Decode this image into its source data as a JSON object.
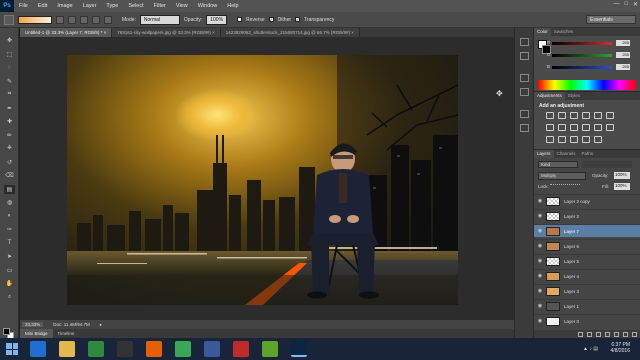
{
  "app": {
    "logo": "Ps"
  },
  "menu": [
    "File",
    "Edit",
    "Image",
    "Layer",
    "Type",
    "Select",
    "Filter",
    "View",
    "Window",
    "Help"
  ],
  "window_controls": {
    "minimize": "—",
    "maximize": "□",
    "close": "✕"
  },
  "options": {
    "mode_label": "Mode:",
    "mode_value": "Normal",
    "opacity_label": "Opacity:",
    "opacity_value": "100%",
    "reverse_label": "Reverse",
    "dither_label": "Dither",
    "transparency_label": "Transparency",
    "reverse_checked": false,
    "dither_checked": true,
    "transparency_checked": true,
    "workspace": "Essentials"
  },
  "doc_tabs": [
    {
      "label": "Untitled-1 @ 33.3% (Layer 7, RGB/8) *",
      "close": "×",
      "active": true
    },
    {
      "label": "769161-city-wallpapers.jpg @ 33.3% (RGB/8#)",
      "close": "×",
      "active": false
    },
    {
      "label": "1423829062_shutterstock_215680714.jpg @ 66.7% (RGB/8#)",
      "close": "×",
      "active": false
    }
  ],
  "status": {
    "zoom": "33.33%",
    "doc": "Doc: 11.4M/94.7M"
  },
  "bottom_tabs": [
    "Mini Bridge",
    "Timeline"
  ],
  "tools": [
    "move-tool-icon",
    "marquee-tool-icon",
    "lasso-tool-icon",
    "quick-select-tool-icon",
    "crop-tool-icon",
    "eyedropper-tool-icon",
    "healing-tool-icon",
    "brush-tool-icon",
    "clone-stamp-tool-icon",
    "history-brush-tool-icon",
    "eraser-tool-icon",
    "gradient-tool-icon",
    "blur-tool-icon",
    "dodge-tool-icon",
    "pen-tool-icon",
    "type-tool-icon",
    "path-select-tool-icon",
    "shape-tool-icon",
    "hand-tool-icon",
    "zoom-tool-icon"
  ],
  "color_panel": {
    "tabs": [
      "Color",
      "Swatches"
    ],
    "channels": [
      {
        "label": "R",
        "value": "255"
      },
      {
        "label": "G",
        "value": "255"
      },
      {
        "label": "B",
        "value": "255"
      }
    ],
    "channel_colors": [
      "#d03030",
      "#30a030",
      "#3050d0"
    ]
  },
  "adjustments_panel": {
    "tabs": [
      "Adjustments",
      "Styles"
    ],
    "heading": "Add an adjustment"
  },
  "layers_panel": {
    "tabs": [
      "Layers",
      "Channels",
      "Paths"
    ],
    "kind": "Kind",
    "blend": "Multiply",
    "opacity_label": "Opacity:",
    "opacity_value": "100%",
    "lock_label": "Lock:",
    "fill_label": "Fill:",
    "fill_value": "100%",
    "visibility_icon": "◉",
    "layers": [
      {
        "name": "Layer 2 copy",
        "thumb": "checker",
        "selected": false
      },
      {
        "name": "Layer 2",
        "thumb": "checker",
        "selected": false
      },
      {
        "name": "Layer 7",
        "thumb": "#b8784a",
        "selected": true
      },
      {
        "name": "Layer 6",
        "thumb": "#c08850",
        "selected": false
      },
      {
        "name": "Layer 5",
        "thumb": "checker",
        "selected": false
      },
      {
        "name": "Layer 4",
        "thumb": "#d49a58",
        "selected": false
      },
      {
        "name": "Layer 3",
        "thumb": "#e0a860",
        "selected": false
      },
      {
        "name": "Layer 1",
        "thumb": "#555555",
        "selected": false
      },
      {
        "name": "Layer 0",
        "thumb": "#f2f2f2",
        "selected": false
      }
    ]
  },
  "taskbar": {
    "apps": [
      {
        "name": "edge-icon",
        "color": "#1f6fd1"
      },
      {
        "name": "file-explorer-icon",
        "color": "#e5b84c"
      },
      {
        "name": "windows-store-icon",
        "color": "#2e8b3d"
      },
      {
        "name": "obs-icon",
        "color": "#333333"
      },
      {
        "name": "firefox-icon",
        "color": "#e66000"
      },
      {
        "name": "chrome-icon",
        "color": "#3aa757"
      },
      {
        "name": "facebook-icon",
        "color": "#3b5998"
      },
      {
        "name": "media-icon",
        "color": "#c22a2a"
      },
      {
        "name": "utorrent-icon",
        "color": "#5fa329"
      },
      {
        "name": "photoshop-icon",
        "color": "#0c2541"
      }
    ],
    "time": "6:37 PM",
    "date": "4/8/2016"
  }
}
